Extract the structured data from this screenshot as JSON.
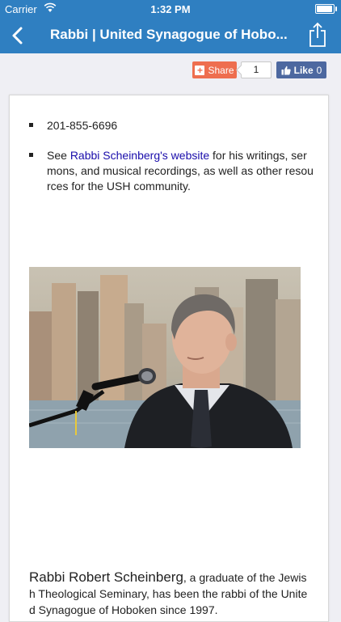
{
  "status_bar": {
    "carrier": "Carrier",
    "time": "1:32 PM",
    "battery_level": 0.95
  },
  "nav": {
    "title": "Rabbi | United Synagogue of Hobo..."
  },
  "social": {
    "share_label": "Share",
    "share_count": "1",
    "like_label": "Like",
    "like_count": "0"
  },
  "content": {
    "phone": "201-855-6696",
    "website_prefix": "See ",
    "website_link": "Rabbi Scheinberg's website",
    "website_suffix": " for his writings, sermons, and musical recordings, as well as other resources for the USH community.",
    "bio_name": "Rabbi Robert Scheinberg",
    "bio_text": ", a graduate of the Jewish Theological Seminary, has been the rabbi of the United Synagogue of Hoboken since 1997."
  },
  "colors": {
    "nav_bg": "#2f7fc1",
    "share_orange": "#ee6e4f",
    "facebook_blue": "#4d68a0",
    "link": "#1a0dab"
  },
  "icons": {
    "back": "chevron-left-icon",
    "share": "share-box-icon",
    "wifi": "wifi-icon"
  }
}
